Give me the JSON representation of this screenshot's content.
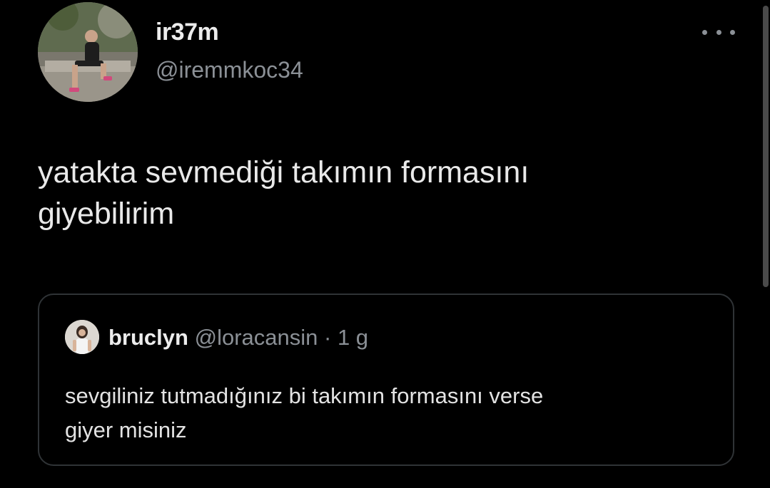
{
  "tweet": {
    "author": {
      "display_name": "ir37m",
      "handle": "@iremmkoc34"
    },
    "text": "yatakta sevmediği takımın formasını\ngiyebilirim",
    "more_icon": "more-horizontal-icon"
  },
  "quoted_tweet": {
    "author": {
      "display_name": "bruclyn",
      "handle": "@loracansin",
      "separator": "·",
      "time": "1 g"
    },
    "text": "sevgiliniz tutmadığınız bi takımın formasını verse\ngiyer misiniz"
  },
  "colors": {
    "background": "#000000",
    "primary_text": "#e7e9ea",
    "secondary_text": "#8b9096",
    "border": "#2f3336"
  }
}
